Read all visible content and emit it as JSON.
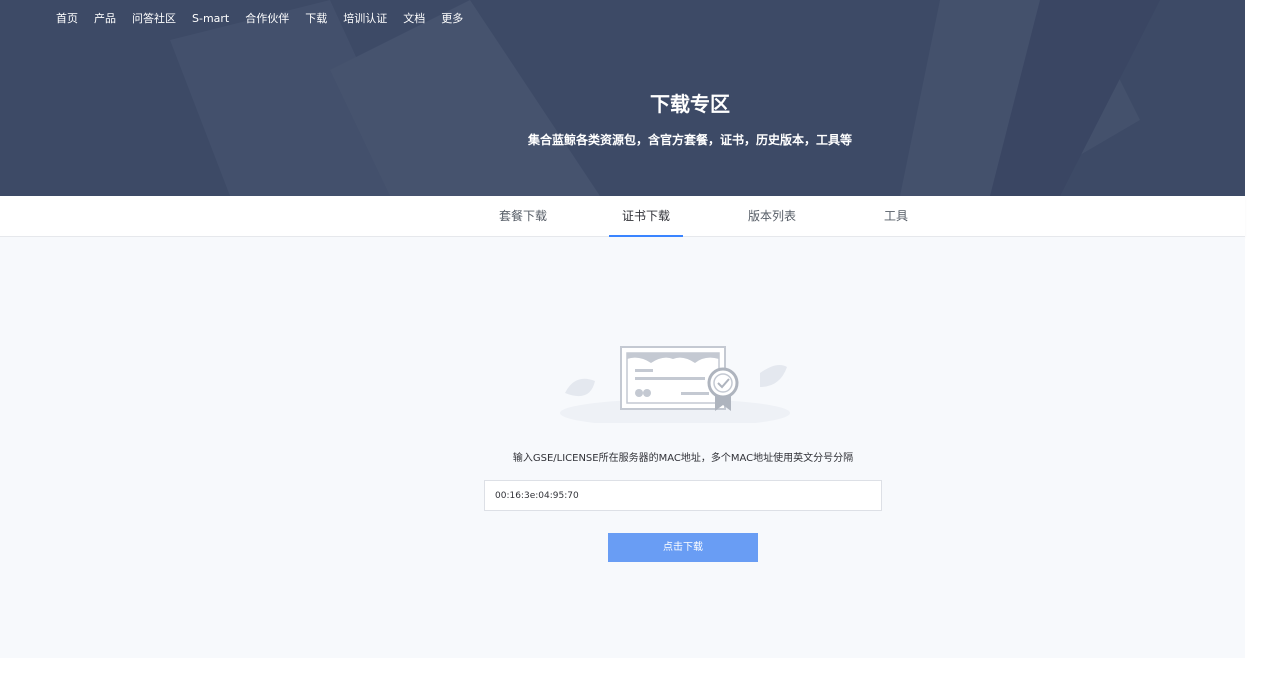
{
  "nav": {
    "items": [
      "首页",
      "产品",
      "问答社区",
      "S-mart",
      "合作伙伴",
      "下载",
      "培训认证",
      "文档",
      "更多"
    ]
  },
  "hero": {
    "title": "下载专区",
    "subtitle": "集合蓝鲸各类资源包，含官方套餐，证书，历史版本，工具等"
  },
  "tabs": {
    "items": [
      "套餐下载",
      "证书下载",
      "版本列表",
      "工具"
    ],
    "active": "证书下载"
  },
  "main": {
    "hint": "输入GSE/LICENSE所在服务器的MAC地址，多个MAC地址使用英文分号分隔",
    "mac_value": "00:16:3e:04:95:70",
    "download_label": "点击下载",
    "illustration_icon": "certificate-icon"
  },
  "colors": {
    "hero_bg": "#3d4a66",
    "accent": "#3a84ff",
    "button": "#699df4",
    "content_bg": "#f7f9fc"
  }
}
